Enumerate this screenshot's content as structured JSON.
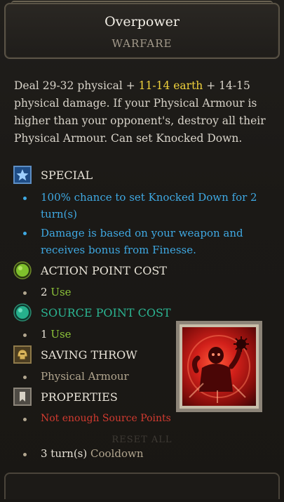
{
  "skill": {
    "name": "Overpower",
    "school": "WARFARE"
  },
  "description": {
    "part1": "Deal 29-32 physical + ",
    "earth": "11-14 earth",
    "part2": " + 14-15 physical damage. If your Physical Armour is higher than your opponent's, destroy all their Physical Armour. Can set Knocked Down."
  },
  "sections": {
    "special": {
      "title": "SPECIAL",
      "icon": "star-icon",
      "items": [
        "100% chance to set Knocked Down for 2 turn(s)",
        "Damage is based on your weapon and receives bonus from Finesse."
      ]
    },
    "action_point_cost": {
      "title": "ACTION POINT COST",
      "icon": "green-orb-icon",
      "value": "2",
      "unit": "Use"
    },
    "source_point_cost": {
      "title": "SOURCE POINT COST",
      "icon": "teal-orb-icon",
      "value": "1",
      "unit": "Use"
    },
    "saving_throw": {
      "title": "SAVING THROW",
      "icon": "helmet-icon",
      "value": "Physical Armour"
    },
    "properties": {
      "title": "PROPERTIES",
      "icon": "bookmark-icon",
      "warning": "Not enough Source Points"
    }
  },
  "cooldown": {
    "value": "3 turn(s)",
    "label": "Cooldown"
  },
  "reset_label": "RESET ALL",
  "colors": {
    "earth": "#f0d23c",
    "special_text": "#3fa9e3",
    "warning": "#d33b30",
    "use": "#8cc33a",
    "source_title": "#2bb592"
  }
}
